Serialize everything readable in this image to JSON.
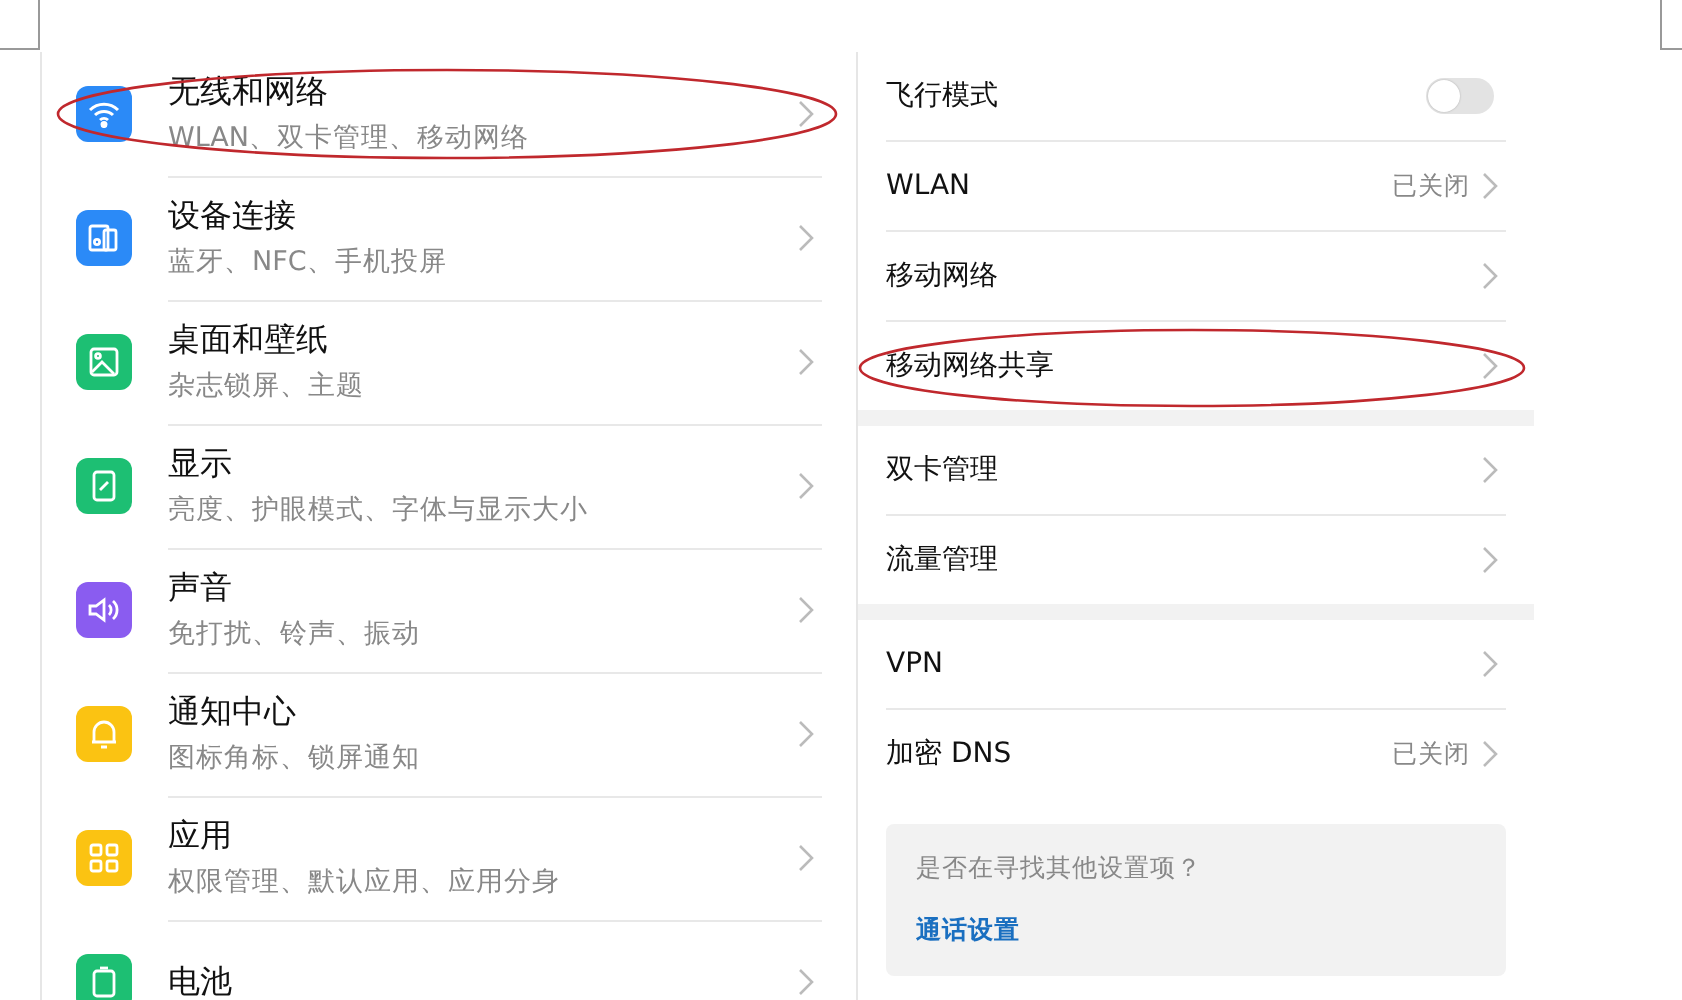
{
  "categories": [
    {
      "title": "无线和网络",
      "subtitle": "WLAN、双卡管理、移动网络",
      "color": "#2b8af7",
      "circled": true
    },
    {
      "title": "设备连接",
      "subtitle": "蓝牙、NFC、手机投屏",
      "color": "#2b8af7",
      "circled": false
    },
    {
      "title": "桌面和壁纸",
      "subtitle": "杂志锁屏、主题",
      "color": "#1dbf73",
      "circled": false
    },
    {
      "title": "显示",
      "subtitle": "亮度、护眼模式、字体与显示大小",
      "color": "#1dbf73",
      "circled": false
    },
    {
      "title": "声音",
      "subtitle": "免打扰、铃声、振动",
      "color": "#8a5cf0",
      "circled": false
    },
    {
      "title": "通知中心",
      "subtitle": "图标角标、锁屏通知",
      "color": "#fbc312",
      "circled": false
    },
    {
      "title": "应用",
      "subtitle": "权限管理、默认应用、应用分身",
      "color": "#fbc312",
      "circled": false
    },
    {
      "title": "电池",
      "color": "#1dbf73",
      "circled": false
    }
  ],
  "detail": {
    "sections": [
      [
        {
          "kind": "toggle",
          "label": "飞行模式",
          "on": false,
          "circled": false
        },
        {
          "kind": "link",
          "label": "WLAN",
          "value": "已关闭",
          "circled": false
        },
        {
          "kind": "link",
          "label": "移动网络",
          "circled": false
        },
        {
          "kind": "link",
          "label": "移动网络共享",
          "circled": true
        }
      ],
      [
        {
          "kind": "link",
          "label": "双卡管理",
          "circled": false
        },
        {
          "kind": "link",
          "label": "流量管理",
          "circled": false
        }
      ],
      [
        {
          "kind": "link",
          "label": "VPN",
          "circled": false
        },
        {
          "kind": "link",
          "label": "加密 DNS",
          "value": "已关闭",
          "circled": false
        }
      ]
    ],
    "suggestion": {
      "question": "是否在寻找其他设置项？",
      "link": "通话设置"
    }
  }
}
